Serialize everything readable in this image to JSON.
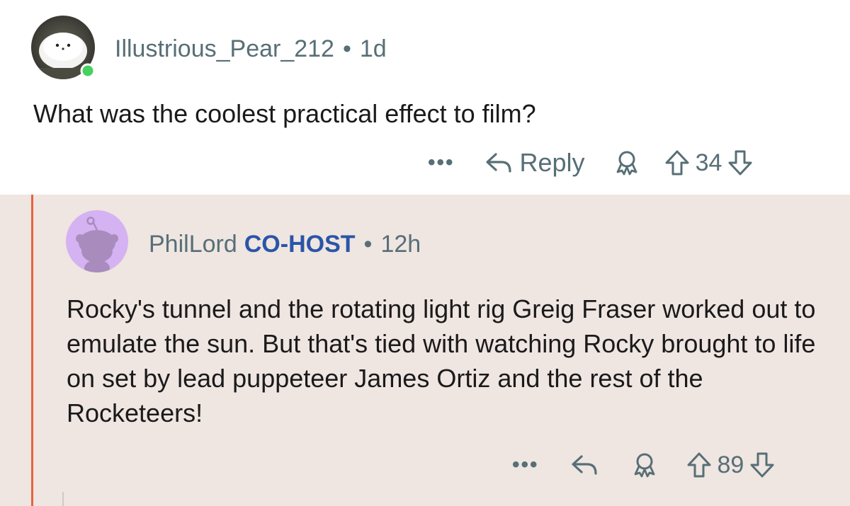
{
  "comments": [
    {
      "username": "Illustrious_Pear_212",
      "separator": "•",
      "time": "1d",
      "body": "What was the coolest practical effect to film?",
      "actions": {
        "more": "•••",
        "reply_label": "Reply",
        "award_icon": "award-icon",
        "upvote_icon": "upvote-arrow-icon",
        "score": "34",
        "downvote_icon": "downvote-arrow-icon"
      },
      "online": true
    },
    {
      "username": "PhilLord",
      "flair": "CO-HOST",
      "separator": "•",
      "time": "12h",
      "body": "Rocky's tunnel and the rotating light rig Greig Fraser worked out to emulate the sun. But that's tied with watching Rocky brought to life on set by lead puppeteer James Ortiz and the rest of the Rocketeers!",
      "actions": {
        "more": "•••",
        "reply_icon": "reply-arrow-icon",
        "award_icon": "award-icon",
        "upvote_icon": "upvote-arrow-icon",
        "score": "89",
        "downvote_icon": "downvote-arrow-icon"
      }
    }
  ],
  "colors": {
    "reply_background": "#efe5e1",
    "thread_line": "#e8633e",
    "flair": "#2a55a8",
    "muted": "#576f76",
    "online": "#46d160",
    "avatar_purple": "#d5b2f2"
  }
}
